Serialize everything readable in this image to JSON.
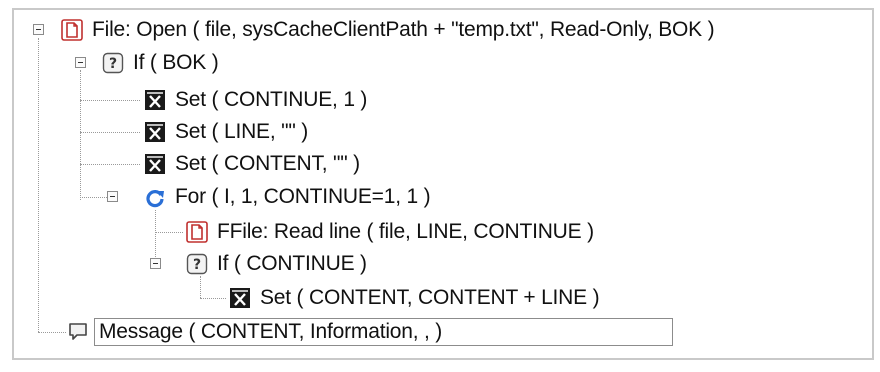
{
  "tree": {
    "nodes": [
      {
        "label": "File: Open ( file, sysCacheClientPath + \"temp.txt\", Read-Only, BOK )",
        "icon": "file-icon"
      },
      {
        "label": "If ( BOK )",
        "icon": "condition-icon"
      },
      {
        "label": "Set ( CONTINUE, 1 )",
        "icon": "set-variable-icon"
      },
      {
        "label": "Set ( LINE, \"\" )",
        "icon": "set-variable-icon"
      },
      {
        "label": "Set ( CONTENT, \"\" )",
        "icon": "set-variable-icon"
      },
      {
        "label": "For ( I, 1, CONTINUE=1, 1 )",
        "icon": "loop-icon"
      },
      {
        "label": "FFile: Read line ( file, LINE, CONTINUE )",
        "icon": "file-icon"
      },
      {
        "label": "If ( CONTINUE )",
        "icon": "condition-icon"
      },
      {
        "label": "Set ( CONTENT, CONTENT + LINE )",
        "icon": "set-variable-icon"
      },
      {
        "label": "Message ( CONTENT, Information, ,  )",
        "icon": "message-icon"
      }
    ]
  },
  "colors": {
    "file_icon": "#c0302f",
    "loop_icon": "#2a6fd6",
    "set_icon": "#1a1a1a"
  }
}
